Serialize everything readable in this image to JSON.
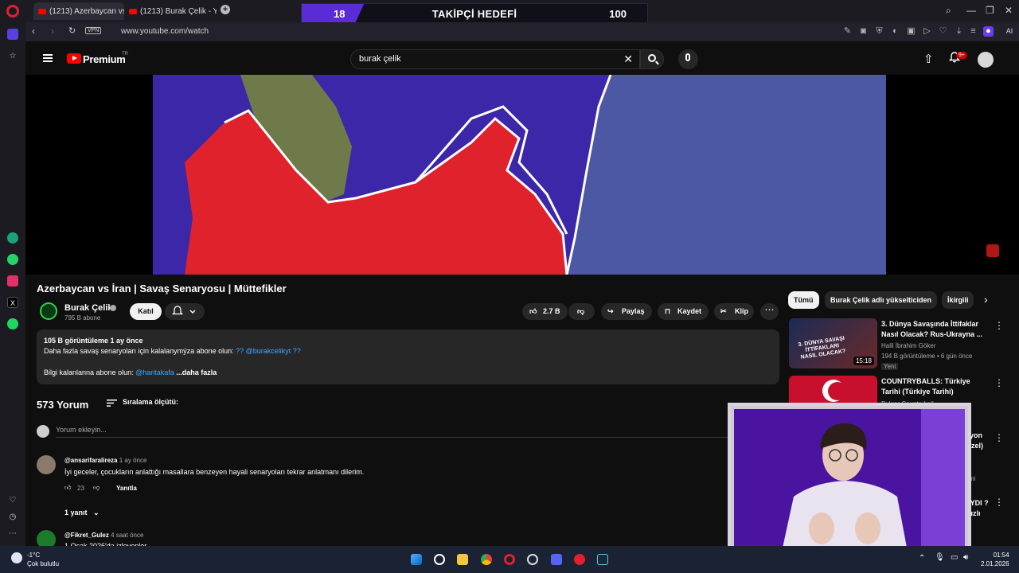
{
  "browser": {
    "tabs": [
      {
        "title": "(1213) Azerbaycan vs İran",
        "active": true
      },
      {
        "title": "(1213) Burak Çelik - YouTu",
        "active": false
      }
    ],
    "url": "www.youtube.com/watch",
    "vpn_label": "VPN",
    "ai_label": "AI"
  },
  "stream_overlay": {
    "current": "18",
    "title": "TAKİPÇİ HEDEFİ",
    "target": "100",
    "progress_fraction": 0.18
  },
  "youtube": {
    "brand": "Premium",
    "region": "TR",
    "search_value": "burak çelik",
    "notifications": "9+"
  },
  "video": {
    "title": "Azerbaycan vs İran | Savaş Senaryosu | Müttefikler",
    "channel": "Burak Çelik",
    "subscribers": "795 B abone",
    "join_label": "Katıl",
    "likes": "2.7 B",
    "share_label": "Paylaş",
    "save_label": "Kaydet",
    "clip_label": "Klip",
    "description": {
      "meta": "105 B görüntüleme  1 ay önce",
      "line1_text": "Daha fazla savaş senaryoları için kalalanymýza abone olun: ",
      "line1_link": "?? @burakcelikyt ??",
      "line2_text": "Bilgi kalanlanna abone olun: ",
      "line2_link": "@haritakafa",
      "more": "...daha fazla"
    }
  },
  "comments": {
    "count_label": "573 Yorum",
    "sort_label": "Sıralama ölçütü:",
    "add_placeholder": "Yorum ekleyin...",
    "items": [
      {
        "author": "@ansarifaralireza",
        "time": "1 ay önce",
        "text": "İyi geceler, çocukların anlattığı masallara benzeyen hayali senaryoları tekrar anlatmanı dilerim.",
        "likes": "23",
        "reply_label": "Yanıtla",
        "replies": "1 yanıt"
      },
      {
        "author": "@Fikret_Gulez",
        "time": "4 saat önce",
        "text": "1 Ocak 2026'da izleyenler"
      }
    ]
  },
  "sidebar_right": {
    "chips": [
      "Tümü",
      "Burak Çelik adlı yükselticiden",
      "İkirgili"
    ],
    "recommended": [
      {
        "title": "3. Dünya Savaşında İttifaklar Nasıl Olacak? Rus-Ukrayna ...",
        "channel": "Halil İbrahim Göker",
        "meta": "194 B görüntüleme • 6 gün önce",
        "badge": "Yeni",
        "duration": "15:18",
        "thumb_text": "3. DÜNYA SAVAŞI İTTİFAKLARI NASIL OLACAK?"
      },
      {
        "title": "COUNTRYBALLS: Türkiye Tarihi (Türkiye Tarihi)",
        "channel": "Bulgar Countryball"
      }
    ],
    "partial_titles": [
      "llyon",
      "Özel)",
      "AYDI ? -",
      "Hızlı"
    ],
    "partial_meta": "ymi"
  },
  "taskbar": {
    "temperature": "-1°C",
    "weather": "Çok bulutlu",
    "time": "01:54",
    "date": "2.01.2026"
  },
  "colors": {
    "page_bg": "#0f0f0f",
    "map_red": "#e0222c",
    "map_purple": "#3b27a8",
    "map_sea": "#4c58a3",
    "goal_purple": "#5b2bd8",
    "link_blue": "#3ea6ff"
  }
}
